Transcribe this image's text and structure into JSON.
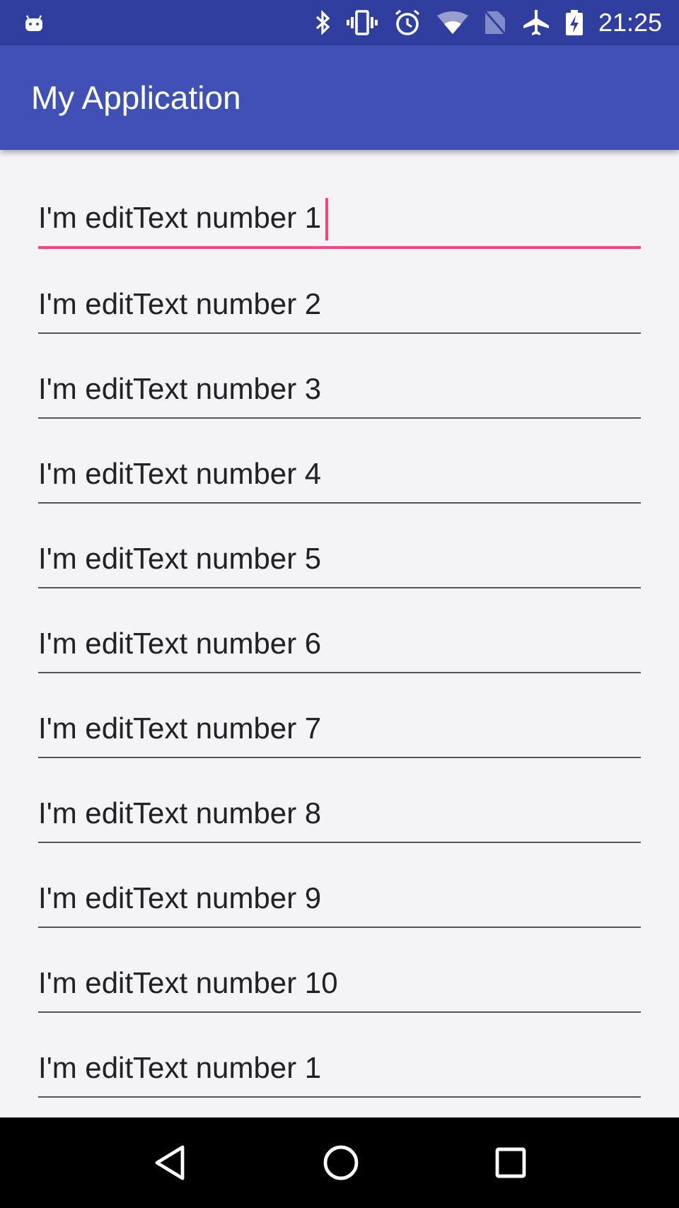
{
  "status_bar": {
    "time": "21:25"
  },
  "app_bar": {
    "title": "My Application"
  },
  "fields": [
    {
      "value": "I'm editText number 1",
      "focused": true
    },
    {
      "value": "I'm editText number 2",
      "focused": false
    },
    {
      "value": "I'm editText number 3",
      "focused": false
    },
    {
      "value": "I'm editText number 4",
      "focused": false
    },
    {
      "value": "I'm editText number 5",
      "focused": false
    },
    {
      "value": "I'm editText number 6",
      "focused": false
    },
    {
      "value": "I'm editText number 7",
      "focused": false
    },
    {
      "value": "I'm editText number 8",
      "focused": false
    },
    {
      "value": "I'm editText number 9",
      "focused": false
    },
    {
      "value": "I'm editText number 10",
      "focused": false
    },
    {
      "value": "I'm editText number 1",
      "focused": false
    }
  ]
}
